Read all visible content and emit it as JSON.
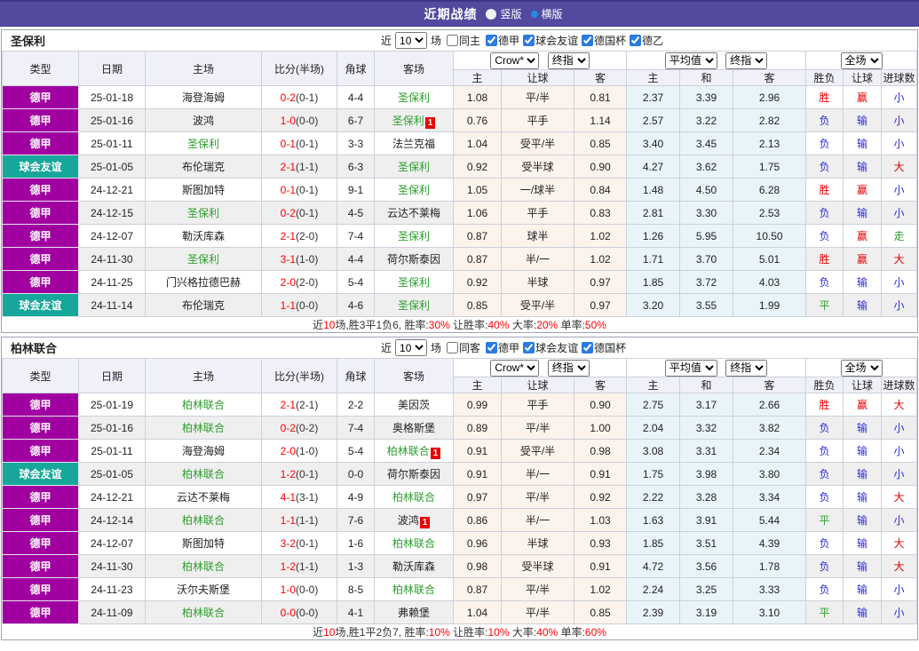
{
  "title_bar": {
    "title": "近期战绩",
    "view_options": [
      {
        "label": "竖版",
        "selected": false
      },
      {
        "label": "横版",
        "selected": true
      }
    ]
  },
  "colors": {
    "title_bar_bg": "#514A9E",
    "league_badge": {
      "德甲": "#A100A1",
      "球会友谊": "#16A79A"
    },
    "focus_team_green": "#2E9E2E",
    "score_red": "#FF0000",
    "result_red": "#E60000",
    "result_blue": "#2B2BD5",
    "result_green": "#2E9E2E",
    "odds_col_bg": "#FBF3EC",
    "avg_col_bg": "#E9F4F9"
  },
  "table_header": {
    "type": "类型",
    "date": "日期",
    "home": "主场",
    "score": "比分(半场)",
    "corner": "角球",
    "away": "客场",
    "sub": [
      "主",
      "让球",
      "客",
      "主",
      "和",
      "客",
      "胜负",
      "让球",
      "进球数"
    ]
  },
  "sections": [
    {
      "team": "圣保利",
      "filter": {
        "near": "近",
        "count": "10",
        "games": "场",
        "same": "同主",
        "same_checked": false,
        "leagues": [
          {
            "label": "德甲",
            "checked": true
          },
          {
            "label": "球会友谊",
            "checked": true
          },
          {
            "label": "德国杯",
            "checked": true
          },
          {
            "label": "德乙",
            "checked": true
          }
        ]
      },
      "selects": {
        "odds_company": "Crow*",
        "odds_stage": "终指",
        "avg_source": "平均值",
        "avg_stage": "终指",
        "scope": "全场"
      },
      "rows": [
        {
          "league": "德甲",
          "date": "25-01-18",
          "home": "海登海姆",
          "home_green": false,
          "home_badge": "",
          "score": "0-2",
          "half": "(0-1)",
          "corner": "4-4",
          "away": "圣保利",
          "away_green": true,
          "away_badge": "",
          "odds": [
            "1.08",
            "平/半",
            "0.81"
          ],
          "avg": [
            "2.37",
            "3.39",
            "2.96"
          ],
          "results": [
            [
              "胜",
              "r"
            ],
            [
              "赢",
              "r"
            ],
            [
              "小",
              "b"
            ]
          ]
        },
        {
          "league": "德甲",
          "date": "25-01-16",
          "home": "波鸿",
          "home_green": false,
          "home_badge": "",
          "score": "1-0",
          "half": "(0-0)",
          "corner": "6-7",
          "away": "圣保利",
          "away_green": true,
          "away_badge": "1",
          "odds": [
            "0.76",
            "平手",
            "1.14"
          ],
          "avg": [
            "2.57",
            "3.22",
            "2.82"
          ],
          "results": [
            [
              "负",
              "b"
            ],
            [
              "输",
              "b"
            ],
            [
              "小",
              "b"
            ]
          ]
        },
        {
          "league": "德甲",
          "date": "25-01-11",
          "home": "圣保利",
          "home_green": true,
          "home_badge": "",
          "score": "0-1",
          "half": "(0-1)",
          "corner": "3-3",
          "away": "法兰克福",
          "away_green": false,
          "away_badge": "",
          "odds": [
            "1.04",
            "受平/半",
            "0.85"
          ],
          "avg": [
            "3.40",
            "3.45",
            "2.13"
          ],
          "results": [
            [
              "负",
              "b"
            ],
            [
              "输",
              "b"
            ],
            [
              "小",
              "b"
            ]
          ]
        },
        {
          "league": "球会友谊",
          "date": "25-01-05",
          "home": "布伦瑞克",
          "home_green": false,
          "home_badge": "",
          "score": "2-1",
          "half": "(1-1)",
          "corner": "6-3",
          "away": "圣保利",
          "away_green": true,
          "away_badge": "",
          "odds": [
            "0.92",
            "受半球",
            "0.90"
          ],
          "avg": [
            "4.27",
            "3.62",
            "1.75"
          ],
          "results": [
            [
              "负",
              "b"
            ],
            [
              "输",
              "b"
            ],
            [
              "大",
              "r"
            ]
          ]
        },
        {
          "league": "德甲",
          "date": "24-12-21",
          "home": "斯图加特",
          "home_green": false,
          "home_badge": "",
          "score": "0-1",
          "half": "(0-1)",
          "corner": "9-1",
          "away": "圣保利",
          "away_green": true,
          "away_badge": "",
          "odds": [
            "1.05",
            "一/球半",
            "0.84"
          ],
          "avg": [
            "1.48",
            "4.50",
            "6.28"
          ],
          "results": [
            [
              "胜",
              "r"
            ],
            [
              "赢",
              "r"
            ],
            [
              "小",
              "b"
            ]
          ]
        },
        {
          "league": "德甲",
          "date": "24-12-15",
          "home": "圣保利",
          "home_green": true,
          "home_badge": "",
          "score": "0-2",
          "half": "(0-1)",
          "corner": "4-5",
          "away": "云达不莱梅",
          "away_green": false,
          "away_badge": "",
          "odds": [
            "1.06",
            "平手",
            "0.83"
          ],
          "avg": [
            "2.81",
            "3.30",
            "2.53"
          ],
          "results": [
            [
              "负",
              "b"
            ],
            [
              "输",
              "b"
            ],
            [
              "小",
              "b"
            ]
          ]
        },
        {
          "league": "德甲",
          "date": "24-12-07",
          "home": "勒沃库森",
          "home_green": false,
          "home_badge": "",
          "score": "2-1",
          "half": "(2-0)",
          "corner": "7-4",
          "away": "圣保利",
          "away_green": true,
          "away_badge": "",
          "odds": [
            "0.87",
            "球半",
            "1.02"
          ],
          "avg": [
            "1.26",
            "5.95",
            "10.50"
          ],
          "results": [
            [
              "负",
              "b"
            ],
            [
              "赢",
              "r"
            ],
            [
              "走",
              "g"
            ]
          ]
        },
        {
          "league": "德甲",
          "date": "24-11-30",
          "home": "圣保利",
          "home_green": true,
          "home_badge": "",
          "score": "3-1",
          "half": "(1-0)",
          "corner": "4-4",
          "away": "荷尔斯泰因",
          "away_green": false,
          "away_badge": "",
          "odds": [
            "0.87",
            "半/一",
            "1.02"
          ],
          "avg": [
            "1.71",
            "3.70",
            "5.01"
          ],
          "results": [
            [
              "胜",
              "r"
            ],
            [
              "赢",
              "r"
            ],
            [
              "大",
              "r"
            ]
          ]
        },
        {
          "league": "德甲",
          "date": "24-11-25",
          "home": "门兴格拉德巴赫",
          "home_green": false,
          "home_badge": "",
          "score": "2-0",
          "half": "(2-0)",
          "corner": "5-4",
          "away": "圣保利",
          "away_green": true,
          "away_badge": "",
          "odds": [
            "0.92",
            "半球",
            "0.97"
          ],
          "avg": [
            "1.85",
            "3.72",
            "4.03"
          ],
          "results": [
            [
              "负",
              "b"
            ],
            [
              "输",
              "b"
            ],
            [
              "小",
              "b"
            ]
          ]
        },
        {
          "league": "球会友谊",
          "date": "24-11-14",
          "home": "布伦瑞克",
          "home_green": false,
          "home_badge": "",
          "score": "1-1",
          "half": "(0-0)",
          "corner": "4-6",
          "away": "圣保利",
          "away_green": true,
          "away_badge": "",
          "odds": [
            "0.85",
            "受平/半",
            "0.97"
          ],
          "avg": [
            "3.20",
            "3.55",
            "1.99"
          ],
          "results": [
            [
              "平",
              "g"
            ],
            [
              "输",
              "b"
            ],
            [
              "小",
              "b"
            ]
          ]
        }
      ],
      "summary": [
        [
          "近",
          false
        ],
        [
          "10",
          true
        ],
        [
          "场,胜3平1负6, 胜率:",
          false
        ],
        [
          "30%",
          true
        ],
        [
          " 让胜率:",
          false
        ],
        [
          "40%",
          true
        ],
        [
          " 大率:",
          false
        ],
        [
          "20%",
          true
        ],
        [
          " 单率:",
          false
        ],
        [
          "50%",
          true
        ]
      ]
    },
    {
      "team": "柏林联合",
      "filter": {
        "near": "近",
        "count": "10",
        "games": "场",
        "same": "同客",
        "same_checked": false,
        "leagues": [
          {
            "label": "德甲",
            "checked": true
          },
          {
            "label": "球会友谊",
            "checked": true
          },
          {
            "label": "德国杯",
            "checked": true
          }
        ]
      },
      "selects": {
        "odds_company": "Crow*",
        "odds_stage": "终指",
        "avg_source": "平均值",
        "avg_stage": "终指",
        "scope": "全场"
      },
      "rows": [
        {
          "league": "德甲",
          "date": "25-01-19",
          "home": "柏林联合",
          "home_green": true,
          "home_badge": "",
          "score": "2-1",
          "half": "(2-1)",
          "corner": "2-2",
          "away": "美因茨",
          "away_green": false,
          "away_badge": "",
          "odds": [
            "0.99",
            "平手",
            "0.90"
          ],
          "avg": [
            "2.75",
            "3.17",
            "2.66"
          ],
          "results": [
            [
              "胜",
              "r"
            ],
            [
              "赢",
              "r"
            ],
            [
              "大",
              "r"
            ]
          ]
        },
        {
          "league": "德甲",
          "date": "25-01-16",
          "home": "柏林联合",
          "home_green": true,
          "home_badge": "",
          "score": "0-2",
          "half": "(0-2)",
          "corner": "7-4",
          "away": "奥格斯堡",
          "away_green": false,
          "away_badge": "",
          "odds": [
            "0.89",
            "平/半",
            "1.00"
          ],
          "avg": [
            "2.04",
            "3.32",
            "3.82"
          ],
          "results": [
            [
              "负",
              "b"
            ],
            [
              "输",
              "b"
            ],
            [
              "小",
              "b"
            ]
          ]
        },
        {
          "league": "德甲",
          "date": "25-01-11",
          "home": "海登海姆",
          "home_green": false,
          "home_badge": "",
          "score": "2-0",
          "half": "(1-0)",
          "corner": "5-4",
          "away": "柏林联合",
          "away_green": true,
          "away_badge": "1",
          "odds": [
            "0.91",
            "受平/半",
            "0.98"
          ],
          "avg": [
            "3.08",
            "3.31",
            "2.34"
          ],
          "results": [
            [
              "负",
              "b"
            ],
            [
              "输",
              "b"
            ],
            [
              "小",
              "b"
            ]
          ]
        },
        {
          "league": "球会友谊",
          "date": "25-01-05",
          "home": "柏林联合",
          "home_green": true,
          "home_badge": "",
          "score": "1-2",
          "half": "(0-1)",
          "corner": "0-0",
          "away": "荷尔斯泰因",
          "away_green": false,
          "away_badge": "",
          "odds": [
            "0.91",
            "半/一",
            "0.91"
          ],
          "avg": [
            "1.75",
            "3.98",
            "3.80"
          ],
          "results": [
            [
              "负",
              "b"
            ],
            [
              "输",
              "b"
            ],
            [
              "小",
              "b"
            ]
          ]
        },
        {
          "league": "德甲",
          "date": "24-12-21",
          "home": "云达不莱梅",
          "home_green": false,
          "home_badge": "",
          "score": "4-1",
          "half": "(3-1)",
          "corner": "4-9",
          "away": "柏林联合",
          "away_green": true,
          "away_badge": "",
          "odds": [
            "0.97",
            "平/半",
            "0.92"
          ],
          "avg": [
            "2.22",
            "3.28",
            "3.34"
          ],
          "results": [
            [
              "负",
              "b"
            ],
            [
              "输",
              "b"
            ],
            [
              "大",
              "r"
            ]
          ]
        },
        {
          "league": "德甲",
          "date": "24-12-14",
          "home": "柏林联合",
          "home_green": true,
          "home_badge": "",
          "score": "1-1",
          "half": "(1-1)",
          "corner": "7-6",
          "away": "波鸿",
          "away_green": false,
          "away_badge": "1",
          "odds": [
            "0.86",
            "半/一",
            "1.03"
          ],
          "avg": [
            "1.63",
            "3.91",
            "5.44"
          ],
          "results": [
            [
              "平",
              "g"
            ],
            [
              "输",
              "b"
            ],
            [
              "小",
              "b"
            ]
          ]
        },
        {
          "league": "德甲",
          "date": "24-12-07",
          "home": "斯图加特",
          "home_green": false,
          "home_badge": "",
          "score": "3-2",
          "half": "(0-1)",
          "corner": "1-6",
          "away": "柏林联合",
          "away_green": true,
          "away_badge": "",
          "odds": [
            "0.96",
            "半球",
            "0.93"
          ],
          "avg": [
            "1.85",
            "3.51",
            "4.39"
          ],
          "results": [
            [
              "负",
              "b"
            ],
            [
              "输",
              "b"
            ],
            [
              "大",
              "r"
            ]
          ]
        },
        {
          "league": "德甲",
          "date": "24-11-30",
          "home": "柏林联合",
          "home_green": true,
          "home_badge": "",
          "score": "1-2",
          "half": "(1-1)",
          "corner": "1-3",
          "away": "勒沃库森",
          "away_green": false,
          "away_badge": "",
          "odds": [
            "0.98",
            "受半球",
            "0.91"
          ],
          "avg": [
            "4.72",
            "3.56",
            "1.78"
          ],
          "results": [
            [
              "负",
              "b"
            ],
            [
              "输",
              "b"
            ],
            [
              "大",
              "r"
            ]
          ]
        },
        {
          "league": "德甲",
          "date": "24-11-23",
          "home": "沃尔夫斯堡",
          "home_green": false,
          "home_badge": "",
          "score": "1-0",
          "half": "(0-0)",
          "corner": "8-5",
          "away": "柏林联合",
          "away_green": true,
          "away_badge": "",
          "odds": [
            "0.87",
            "平/半",
            "1.02"
          ],
          "avg": [
            "2.24",
            "3.25",
            "3.33"
          ],
          "results": [
            [
              "负",
              "b"
            ],
            [
              "输",
              "b"
            ],
            [
              "小",
              "b"
            ]
          ]
        },
        {
          "league": "德甲",
          "date": "24-11-09",
          "home": "柏林联合",
          "home_green": true,
          "home_badge": "",
          "score": "0-0",
          "half": "(0-0)",
          "corner": "4-1",
          "away": "弗赖堡",
          "away_green": false,
          "away_badge": "",
          "odds": [
            "1.04",
            "平/半",
            "0.85"
          ],
          "avg": [
            "2.39",
            "3.19",
            "3.10"
          ],
          "results": [
            [
              "平",
              "g"
            ],
            [
              "输",
              "b"
            ],
            [
              "小",
              "b"
            ]
          ]
        }
      ],
      "summary": [
        [
          "近",
          false
        ],
        [
          "10",
          true
        ],
        [
          "场,胜1平2负7, 胜率:",
          false
        ],
        [
          "10%",
          true
        ],
        [
          " 让胜率:",
          false
        ],
        [
          "10%",
          true
        ],
        [
          " 大率:",
          false
        ],
        [
          "40%",
          true
        ],
        [
          " 单率:",
          false
        ],
        [
          "60%",
          true
        ]
      ]
    }
  ]
}
